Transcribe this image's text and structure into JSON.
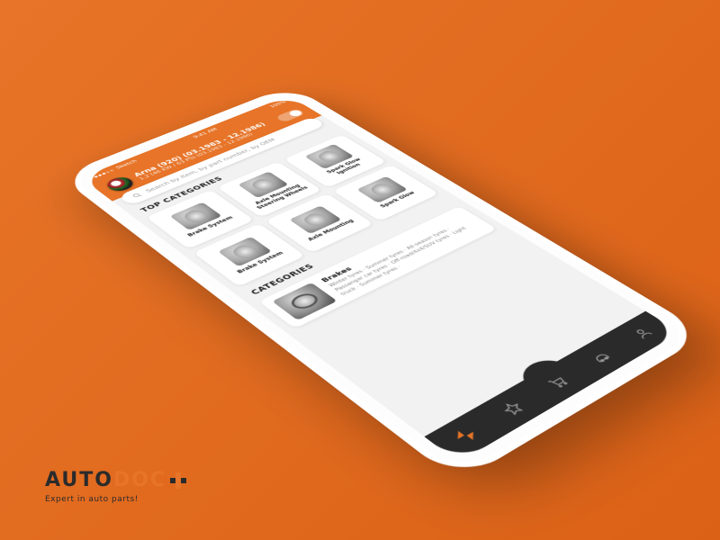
{
  "brand": {
    "name_a": "AUTO",
    "name_b": "DOC",
    "tagline": "Expert in auto parts!"
  },
  "status": {
    "carrier": "Sketch",
    "time": "9:41 AM",
    "battery": "100%"
  },
  "header": {
    "title": "Arna (920) (03.1983 - 12.1986)",
    "subtitle": "1.2 (46 KW / 63 PS) (03.1983 - 12.1986)"
  },
  "search": {
    "placeholder": "Search by item, by part number, by OEM"
  },
  "top_title": "TOP CATEGORIES",
  "top": [
    {
      "label": "Brake System"
    },
    {
      "label": "Axle Mounting Steering Wheels"
    },
    {
      "label": "Spark Glow Ignition"
    },
    {
      "label": "Brake System"
    },
    {
      "label": "Axle Mounting"
    },
    {
      "label": "Spark Glow"
    }
  ],
  "cat_title": "CATEGORIES",
  "cat_item": {
    "title": "Brakes",
    "sub": "Winter tyres · Summer tyres · All-season tyres · Passanger car tyres · Off-road/4x4/SUV tyres · Light truck · Summer tyres ·"
  }
}
